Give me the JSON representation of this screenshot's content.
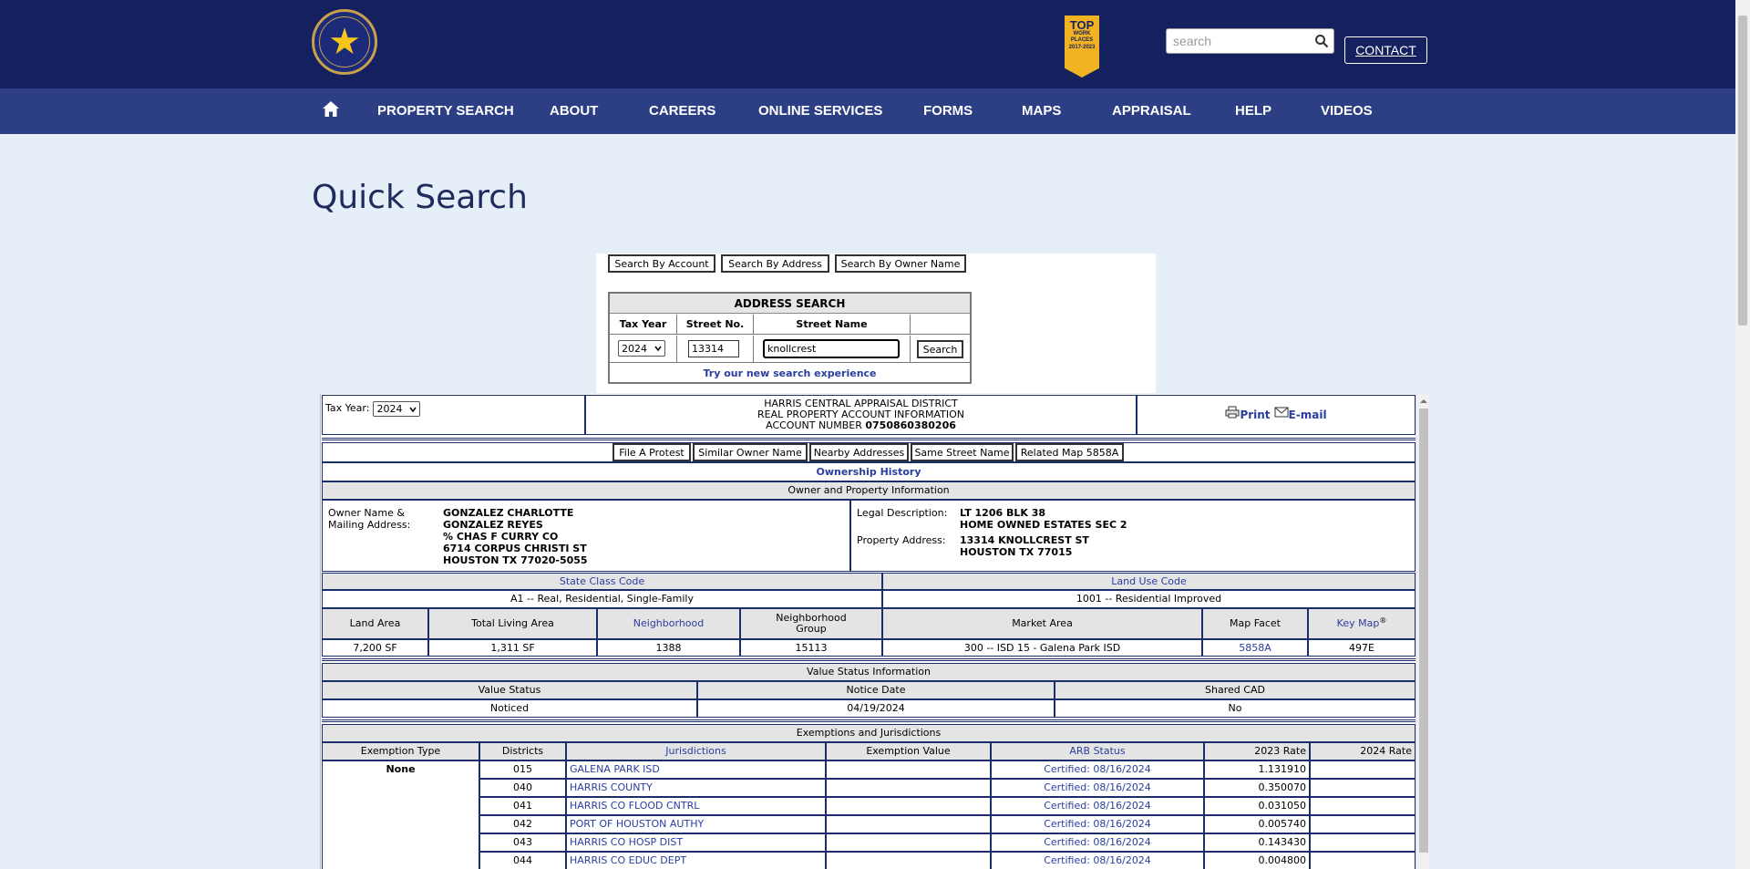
{
  "header": {
    "search_placeholder": "search",
    "contact_label": "CONTACT",
    "badge": {
      "line1": "TOP",
      "line2": "WORK PLACES",
      "line3": "2017-2023"
    }
  },
  "nav": {
    "items": [
      "PROPERTY SEARCH",
      "ABOUT",
      "CAREERS",
      "ONLINE SERVICES",
      "FORMS",
      "MAPS",
      "APPRAISAL",
      "HELP",
      "VIDEOS"
    ]
  },
  "page_title": "Quick Search",
  "search_panel": {
    "buttons": [
      "Search By Account",
      "Search By Address",
      "Search By Owner Name"
    ],
    "title": "ADDRESS SEARCH",
    "headers": [
      "Tax Year",
      "Street No.",
      "Street Name"
    ],
    "tax_year": "2024",
    "street_no": "13314",
    "street_name": "knollcrest",
    "search_button": "Search",
    "new_experience_link": "Try our new search experience"
  },
  "result": {
    "tax_year_label": "Tax Year:",
    "tax_year": "2024",
    "district": "HARRIS CENTRAL APPRAISAL DISTRICT",
    "subtitle": "REAL PROPERTY ACCOUNT INFORMATION",
    "account_label": "ACCOUNT NUMBER",
    "account_number": "0750860380206",
    "print_label": "Print",
    "email_label": "E-mail",
    "action_buttons": [
      "File A Protest",
      "Similar Owner Name",
      "Nearby Addresses",
      "Same Street Name",
      "Related Map 5858A"
    ],
    "ownership_history": "Ownership History",
    "owner_section": "Owner and Property Information",
    "owner_label_1": "Owner Name &",
    "owner_label_2": "Mailing Address:",
    "owner_lines": [
      "GONZALEZ CHARLOTTE",
      "GONZALEZ REYES",
      "% CHAS F CURRY CO",
      "6714 CORPUS CHRISTI ST",
      "HOUSTON TX 77020-5055"
    ],
    "legal_label": "Legal Description:",
    "legal_lines": [
      "LT 1206 BLK 38",
      "HOME OWNED ESTATES SEC 2"
    ],
    "address_label": "Property Address:",
    "address_lines": [
      "13314 KNOLLCREST ST",
      "HOUSTON TX 77015"
    ],
    "state_class_code_label": "State Class Code",
    "land_use_code_label": "Land Use Code",
    "state_class_code": "A1 -- Real, Residential, Single-Family",
    "land_use_code": "1001 -- Residential Improved",
    "prop_headers": [
      "Land Area",
      "Total Living Area",
      "Neighborhood",
      "Neighborhood",
      "Group",
      "Market Area",
      "Map Facet",
      "Key Map",
      "®"
    ],
    "prop_values": [
      "7,200 SF",
      "1,311 SF",
      "1388",
      "15113",
      "300 -- ISD 15 - Galena Park ISD",
      "5858A",
      "497E"
    ],
    "value_status_section": "Value Status Information",
    "value_headers": [
      "Value Status",
      "Notice Date",
      "Shared CAD"
    ],
    "value_values": [
      "Noticed",
      "04/19/2024",
      "No"
    ],
    "exemptions_section": "Exemptions and Jurisdictions",
    "exemption_headers": [
      "Exemption Type",
      "Districts",
      "Jurisdictions",
      "Exemption Value",
      "ARB Status",
      "2023 Rate",
      "2024 Rate"
    ],
    "exemption_type": "None",
    "jurisdictions": [
      {
        "district": "015",
        "name": "GALENA PARK ISD",
        "arb": "Certified: 08/16/2024",
        "rate_2023": "1.131910"
      },
      {
        "district": "040",
        "name": "HARRIS COUNTY",
        "arb": "Certified: 08/16/2024",
        "rate_2023": "0.350070"
      },
      {
        "district": "041",
        "name": "HARRIS CO FLOOD CNTRL",
        "arb": "Certified: 08/16/2024",
        "rate_2023": "0.031050"
      },
      {
        "district": "042",
        "name": "PORT OF HOUSTON AUTHY",
        "arb": "Certified: 08/16/2024",
        "rate_2023": "0.005740"
      },
      {
        "district": "043",
        "name": "HARRIS CO HOSP DIST",
        "arb": "Certified: 08/16/2024",
        "rate_2023": "0.143430"
      },
      {
        "district": "044",
        "name": "HARRIS CO EDUC DEPT",
        "arb": "Certified: 08/16/2024",
        "rate_2023": "0.004800"
      }
    ]
  }
}
